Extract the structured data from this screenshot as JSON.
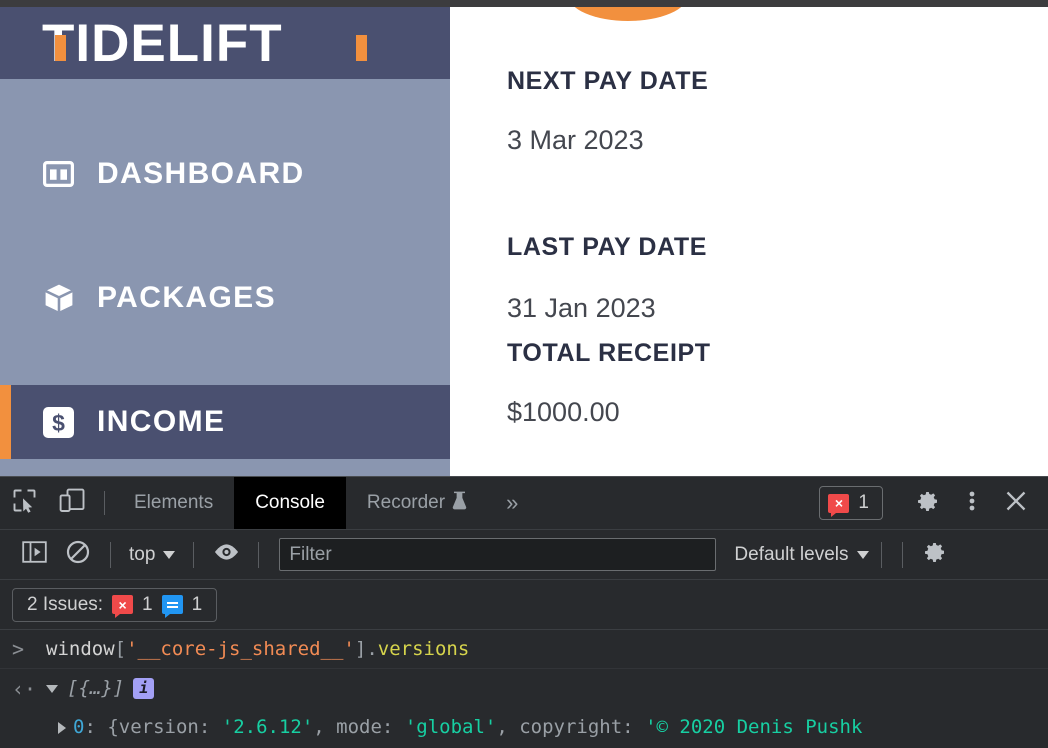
{
  "page": {
    "sidebar": {
      "logo_text": "TIDELIFT",
      "items": [
        {
          "label": "DASHBOARD",
          "icon": "dashboard-icon",
          "active": false
        },
        {
          "label": "PACKAGES",
          "icon": "package-icon",
          "active": false
        },
        {
          "label": "INCOME",
          "icon": "dollar-icon",
          "active": true
        }
      ],
      "colors": {
        "header_bg": "#4a5070",
        "body_bg": "#8a96b0",
        "active_bg": "#4a5070",
        "accent": "#f2903e"
      }
    },
    "main": {
      "stats": [
        {
          "label": "NEXT PAY DATE",
          "value": "3 Mar 2023"
        },
        {
          "label": "LAST PAY DATE",
          "value": "31 Jan 2023"
        },
        {
          "label": "TOTAL RECEIPT",
          "value": "$1000.00"
        }
      ]
    }
  },
  "devtools": {
    "tabs": [
      {
        "label": "Elements",
        "selected": false,
        "experiment": false
      },
      {
        "label": "Console",
        "selected": true,
        "experiment": false
      },
      {
        "label": "Recorder",
        "selected": false,
        "experiment": true
      }
    ],
    "more_tabs_glyph": "»",
    "toolbar_icons": {
      "inspect": "inspect-element-icon",
      "device": "device-toolbar-icon",
      "settings": "gear-icon",
      "kebab": "more-options-icon",
      "close": "close-icon"
    },
    "error_pill": {
      "count": "1",
      "icon": "error-badge-icon"
    },
    "console_toolbar": {
      "sidebar_toggle": "console-sidebar-icon",
      "clear": "clear-console-icon",
      "context": "top",
      "eye": "live-expression-icon",
      "filter_placeholder": "Filter",
      "filter_value": "",
      "levels": "Default levels",
      "settings": "gear-icon"
    },
    "issues_bar": {
      "text": "2 Issues:",
      "error_count": "1",
      "info_count": "1"
    },
    "console": {
      "input_prompt": ">",
      "input_tokens": [
        {
          "t": "window",
          "c": "tok-plain"
        },
        {
          "t": "[",
          "c": "tok-gray"
        },
        {
          "t": "'__core-js_shared__'",
          "c": "tok-str"
        },
        {
          "t": "]",
          "c": "tok-gray"
        },
        {
          "t": ".",
          "c": "tok-gray"
        },
        {
          "t": "versions",
          "c": "tok-prop"
        }
      ],
      "result_prompt": "‹·",
      "result_preview": "[{…}]",
      "result_info_chip": "i",
      "child_tokens": [
        {
          "t": "0",
          "c": "tok-num"
        },
        {
          "t": ": {",
          "c": "tok-gray"
        },
        {
          "t": "version",
          "c": "tok-gray"
        },
        {
          "t": ": ",
          "c": "tok-gray"
        },
        {
          "t": "'2.6.12'",
          "c": "tok-val"
        },
        {
          "t": ", ",
          "c": "tok-gray"
        },
        {
          "t": "mode",
          "c": "tok-gray"
        },
        {
          "t": ": ",
          "c": "tok-gray"
        },
        {
          "t": "'global'",
          "c": "tok-val"
        },
        {
          "t": ", ",
          "c": "tok-gray"
        },
        {
          "t": "copyright",
          "c": "tok-gray"
        },
        {
          "t": ": ",
          "c": "tok-gray"
        },
        {
          "t": "'© 2020 Denis Pushk",
          "c": "tok-val"
        }
      ]
    }
  }
}
